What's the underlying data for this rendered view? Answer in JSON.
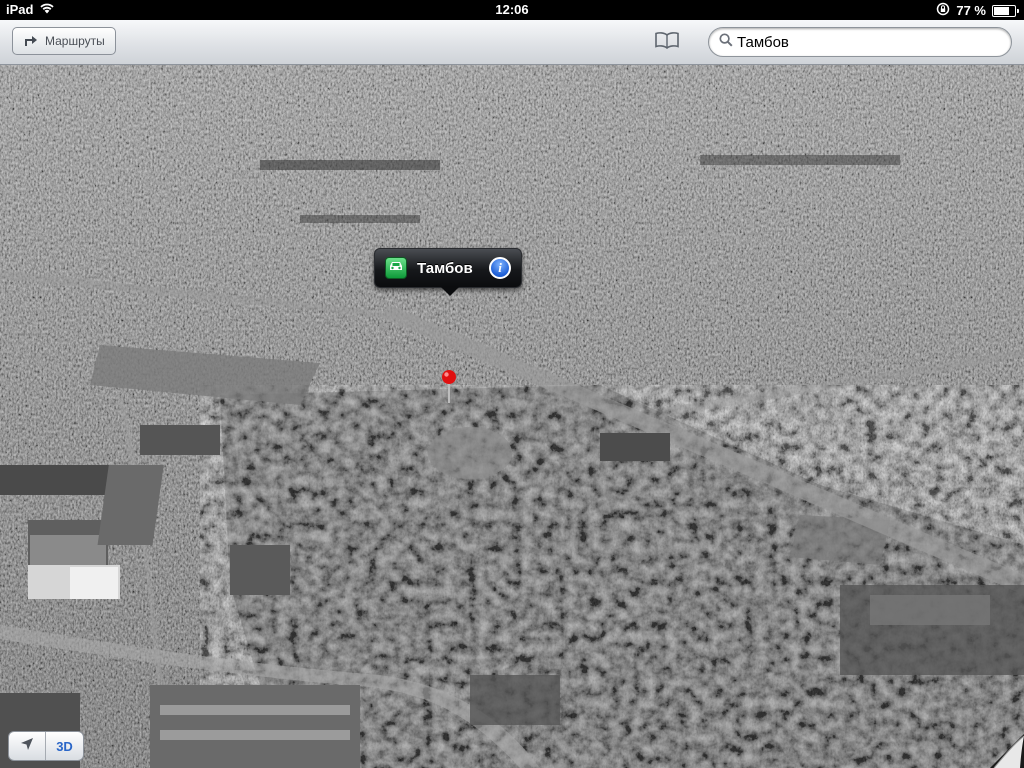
{
  "status_bar": {
    "device": "iPad",
    "time": "12:06",
    "battery_percent": "77 %",
    "battery_level": 0.77
  },
  "toolbar": {
    "routes_label": "Маршруты",
    "search_value": "Тамбов"
  },
  "map": {
    "view_mode": "satellite-3d",
    "callout_title": "Тамбов",
    "pin_color": "#e01010"
  },
  "controls": {
    "three_d_label": "3D"
  },
  "colors": {
    "accent": "#2a66c8",
    "car_button": "#1aa646"
  }
}
